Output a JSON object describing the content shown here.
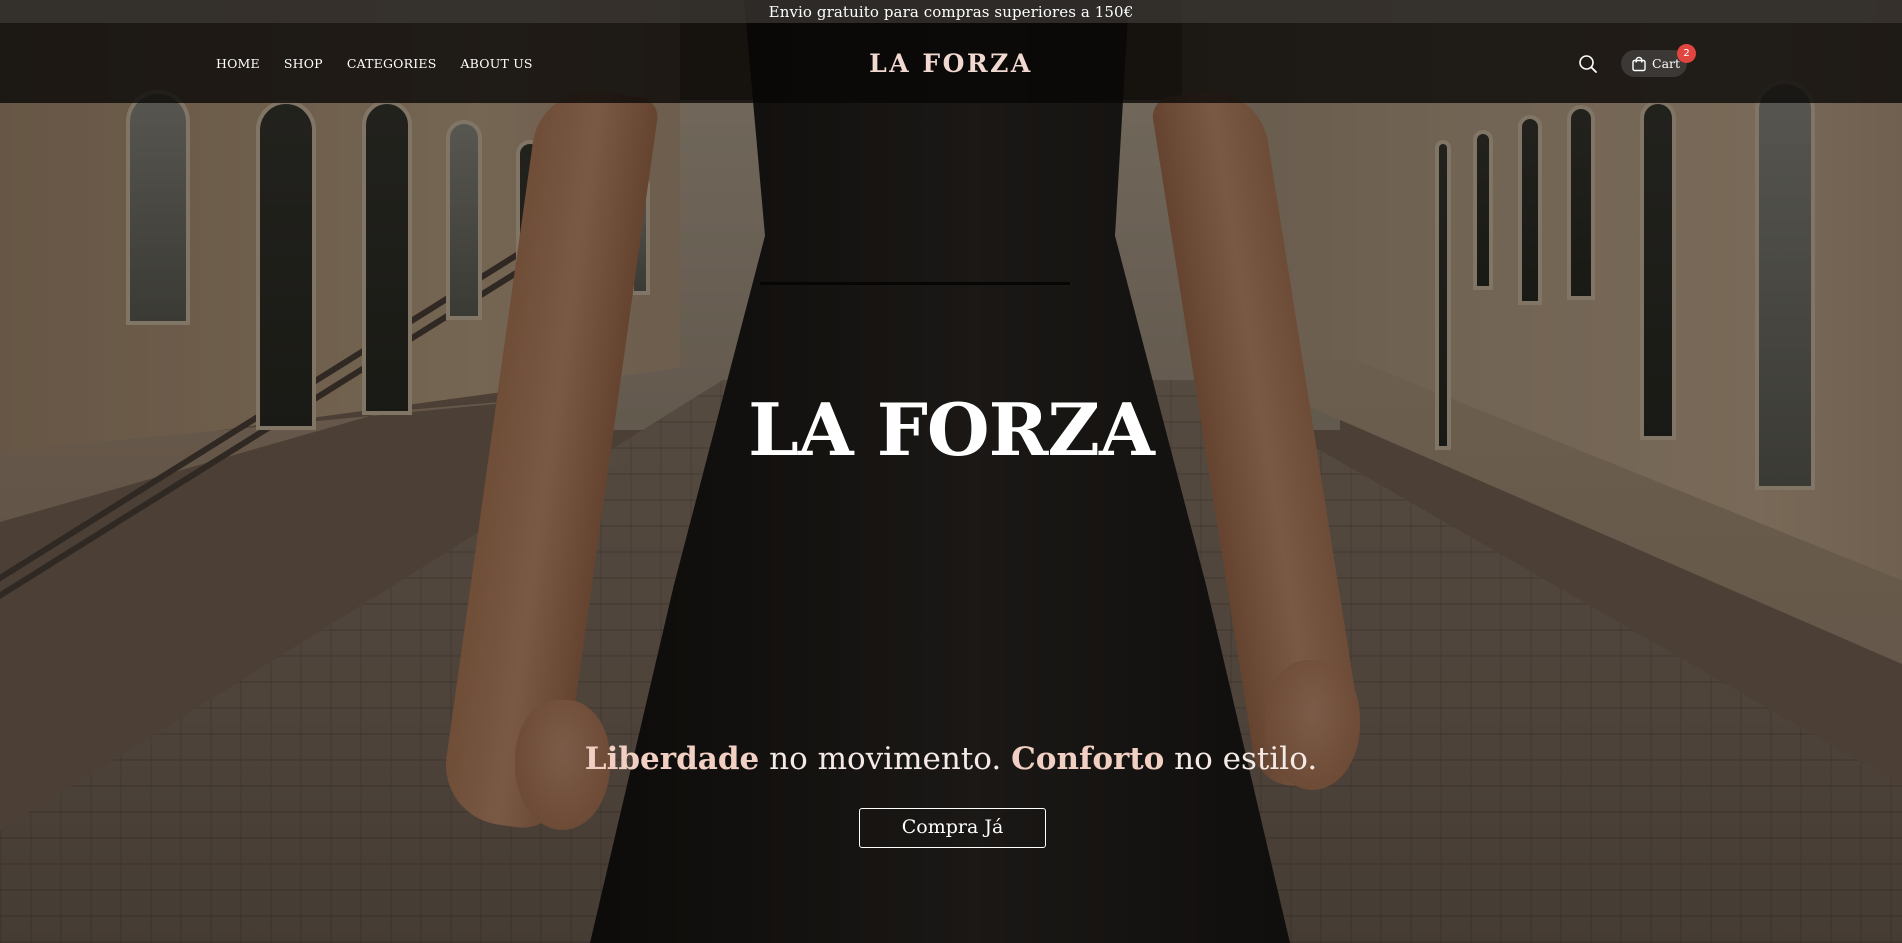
{
  "announcement": "Envio gratuito para compras superiores a 150€",
  "nav": {
    "items": [
      "HOME",
      "SHOP",
      "CATEGORIES",
      "ABOUT US"
    ]
  },
  "brand": "LA FORZA",
  "header_actions": {
    "search_icon": "search-icon",
    "cart_label": "Cart",
    "cart_count": "2",
    "cart_icon": "shopping-bag-icon"
  },
  "hero": {
    "title": "LA FORZA",
    "tagline": {
      "part1": "Liberdade",
      "part2": " no movimento. ",
      "part3": "Conforto",
      "part4": " no estilo."
    },
    "cta_label": "Compra Já"
  },
  "colors": {
    "brand_accent": "#f1d8d0",
    "badge": "#e0453f",
    "header_bg": "#080605"
  }
}
